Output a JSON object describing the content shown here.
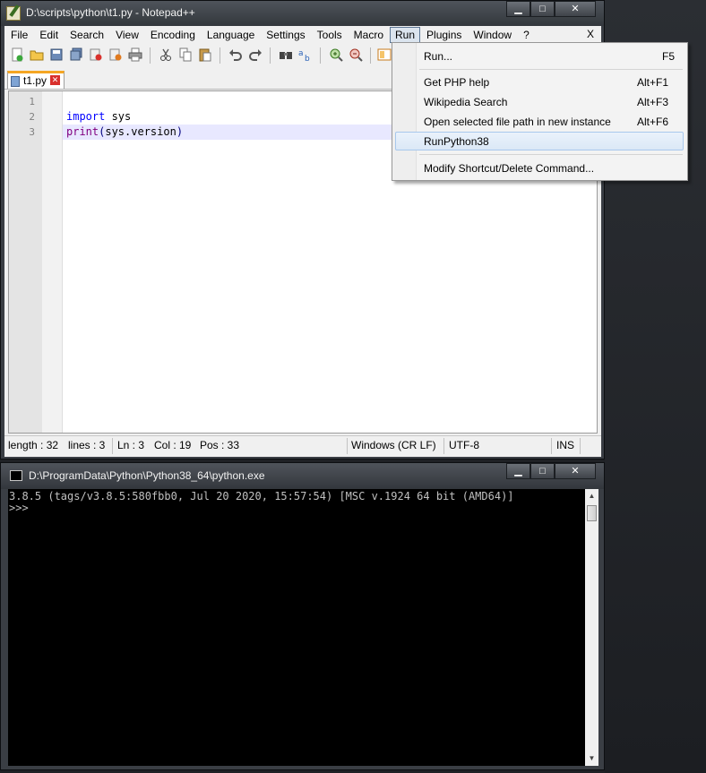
{
  "npp": {
    "title": "D:\\scripts\\python\\t1.py - Notepad++",
    "menu": [
      "File",
      "Edit",
      "Search",
      "View",
      "Encoding",
      "Language",
      "Settings",
      "Tools",
      "Macro",
      "Run",
      "Plugins",
      "Window",
      "?"
    ],
    "menu_close": "X",
    "tab_label": "t1.py",
    "lines": [
      "1",
      "2",
      "3"
    ],
    "code_line2_kw": "import",
    "code_line2_rest": " sys",
    "code_line3_fn": "print",
    "code_line3_open": "(",
    "code_line3_arg": "sys.version",
    "code_line3_close": ")",
    "status": {
      "length": "length : 32",
      "lines": "lines : 3",
      "ln": "Ln : 3",
      "col": "Col : 19",
      "pos": "Pos : 33",
      "eol": "Windows (CR LF)",
      "encoding": "UTF-8",
      "mode": "INS"
    }
  },
  "run_menu": {
    "items": [
      {
        "label": "Run...",
        "key": "F5"
      },
      {
        "label": "Get PHP help",
        "key": "Alt+F1"
      },
      {
        "label": "Wikipedia Search",
        "key": "Alt+F3"
      },
      {
        "label": "Open selected file path in new instance",
        "key": "Alt+F6"
      },
      {
        "label": "RunPython38",
        "key": ""
      },
      {
        "label": "Modify Shortcut/Delete Command...",
        "key": ""
      }
    ]
  },
  "console": {
    "title": "D:\\ProgramData\\Python\\Python38_64\\python.exe",
    "line1": "3.8.5 (tags/v3.8.5:580fbb0, Jul 20 2020, 15:57:54) [MSC v.1924 64 bit (AMD64)]",
    "line2": ">>>"
  },
  "icons": {
    "minimize": "minimize-icon",
    "maximize": "maximize-icon",
    "close": "close-icon",
    "tab_close": "tab-close-icon",
    "app": "notepadpp-icon",
    "console": "console-icon"
  },
  "colors": {
    "keyword": "#0000ff",
    "builtin": "#800080",
    "current_line": "#e8e8ff",
    "tab_accent": "#f5a623"
  }
}
